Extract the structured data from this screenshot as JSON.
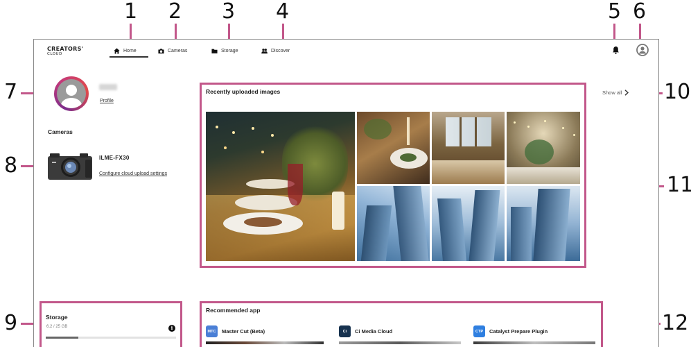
{
  "brand": {
    "name": "CREATORS'",
    "sub": "CLOUD"
  },
  "nav": [
    {
      "label": "Home",
      "icon": "home-icon",
      "active": true
    },
    {
      "label": "Cameras",
      "icon": "camera-icon",
      "active": false
    },
    {
      "label": "Storage",
      "icon": "folder-icon",
      "active": false
    },
    {
      "label": "Discover",
      "icon": "people-icon",
      "active": false
    }
  ],
  "header_icons": {
    "notifications": "bell-icon",
    "account": "account-icon"
  },
  "profile": {
    "link_label": "Profile"
  },
  "cameras": {
    "heading": "Cameras",
    "model": "ILME-FX30",
    "link_label": "Configure cloud upload settings"
  },
  "recent_images": {
    "title": "Recently uploaded images",
    "show_all": "Show all"
  },
  "storage": {
    "title": "Storage",
    "usage": "6.2 / 25 GB",
    "used_fraction": 0.248,
    "info_icon": "info-icon"
  },
  "recommended": {
    "title": "Recommended app",
    "apps": [
      {
        "name": "Master Cut (Beta)",
        "badge": "MTC",
        "color": "#4a7fd6"
      },
      {
        "name": "Ci Media Cloud",
        "badge": "Ci",
        "color": "#17324f"
      },
      {
        "name": "Catalyst Prepare Plugin",
        "badge": "CTP",
        "color": "#2f7fe0"
      }
    ]
  },
  "callouts": [
    "1",
    "2",
    "3",
    "4",
    "5",
    "6",
    "7",
    "8",
    "9",
    "10",
    "11",
    "12"
  ],
  "colors": {
    "callout_frame": "#c2578a",
    "text": "#222222"
  }
}
